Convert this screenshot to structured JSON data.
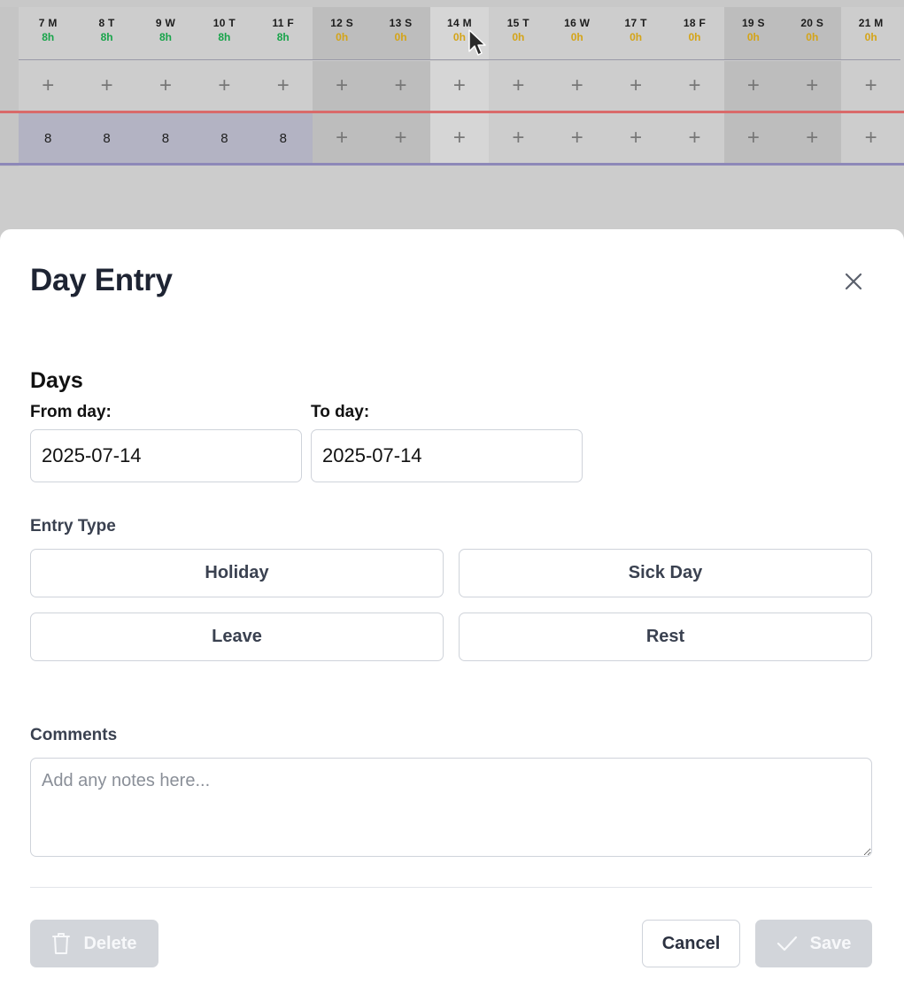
{
  "grid": {
    "days": [
      {
        "label": "7 M",
        "hours": "8h",
        "status": "ok",
        "type": "weekday",
        "entry": "8"
      },
      {
        "label": "8 T",
        "hours": "8h",
        "status": "ok",
        "type": "weekday",
        "entry": "8"
      },
      {
        "label": "9 W",
        "hours": "8h",
        "status": "ok",
        "type": "weekday",
        "entry": "8"
      },
      {
        "label": "10 T",
        "hours": "8h",
        "status": "ok",
        "type": "weekday",
        "entry": "8"
      },
      {
        "label": "11 F",
        "hours": "8h",
        "status": "ok",
        "type": "weekday",
        "entry": "8"
      },
      {
        "label": "12 S",
        "hours": "0h",
        "status": "zero",
        "type": "weekend",
        "entry": ""
      },
      {
        "label": "13 S",
        "hours": "0h",
        "status": "zero",
        "type": "weekend",
        "entry": ""
      },
      {
        "label": "14 M",
        "hours": "0h",
        "status": "zero",
        "type": "selected",
        "entry": ""
      },
      {
        "label": "15 T",
        "hours": "0h",
        "status": "zero",
        "type": "weekday",
        "entry": ""
      },
      {
        "label": "16 W",
        "hours": "0h",
        "status": "zero",
        "type": "weekday",
        "entry": ""
      },
      {
        "label": "17 T",
        "hours": "0h",
        "status": "zero",
        "type": "weekday",
        "entry": ""
      },
      {
        "label": "18 F",
        "hours": "0h",
        "status": "zero",
        "type": "weekday",
        "entry": ""
      },
      {
        "label": "19 S",
        "hours": "0h",
        "status": "zero",
        "type": "weekend",
        "entry": ""
      },
      {
        "label": "20 S",
        "hours": "0h",
        "status": "zero",
        "type": "weekend",
        "entry": ""
      },
      {
        "label": "21 M",
        "hours": "0h",
        "status": "zero",
        "type": "weekday",
        "entry": ""
      }
    ],
    "add_glyph": "+"
  },
  "modal": {
    "title": "Day Entry",
    "days_section_title": "Days",
    "from_label": "From day:",
    "from_value": "2025-07-14",
    "to_label": "To day:",
    "to_value": "2025-07-14",
    "entry_type_label": "Entry Type",
    "entry_types": [
      "Holiday",
      "Sick Day",
      "Leave",
      "Rest"
    ],
    "comments_label": "Comments",
    "comments_placeholder": "Add any notes here...",
    "delete_label": "Delete",
    "cancel_label": "Cancel",
    "save_label": "Save"
  },
  "colors": {
    "hours_ok": "#18a44a",
    "hours_zero": "#d4a417",
    "row_divider_red": "#d96a6a",
    "row_divider_blue": "#8d88b8",
    "disabled_button": "#d2d5da"
  }
}
